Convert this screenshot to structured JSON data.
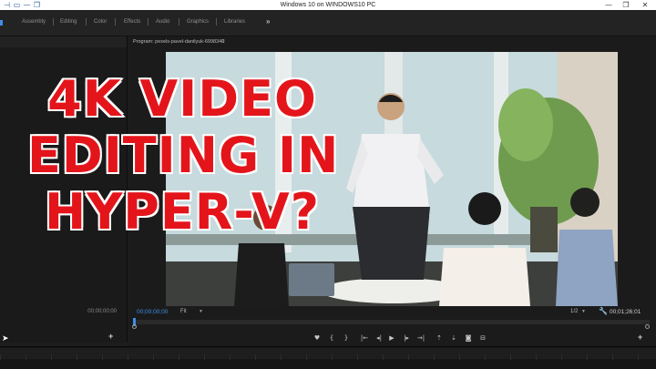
{
  "host": {
    "title": "Windows 10 on WINDOWS10 PC",
    "left_icons": [
      "pin-icon",
      "vm-icon",
      "minimize-icon",
      "restore-icon"
    ],
    "window_controls": [
      "minimize-icon",
      "restore-icon",
      "close-icon"
    ],
    "controls": {
      "minimize": "—",
      "restore": "❐",
      "close": "✕"
    }
  },
  "workspaces": {
    "tabs": [
      "Assembly",
      "Editing",
      "Color",
      "Effects",
      "Audio",
      "Graphics",
      "Libraries"
    ],
    "overflow": "»"
  },
  "program_monitor": {
    "tab_label": "Program: pexels-pavel-danilyuk-6998340",
    "tab_menu": "≡",
    "timecode_current": "00;00;00;00",
    "fit": "Fit",
    "resolution": "1/2",
    "timecode_duration": "00;01;26;01",
    "transport": [
      {
        "name": "add-marker-button",
        "glyph": "♥"
      },
      {
        "name": "mark-in-button",
        "glyph": "{"
      },
      {
        "name": "mark-out-button",
        "glyph": "}"
      },
      {
        "name": "go-to-in-button",
        "glyph": "|←"
      },
      {
        "name": "step-back-button",
        "glyph": "◂|"
      },
      {
        "name": "play-button",
        "glyph": "▶"
      },
      {
        "name": "step-forward-button",
        "glyph": "|▸"
      },
      {
        "name": "go-to-out-button",
        "glyph": "→|"
      },
      {
        "name": "lift-button",
        "glyph": "⇡"
      },
      {
        "name": "extract-button",
        "glyph": "⇣"
      },
      {
        "name": "export-frame-button",
        "glyph": "◙"
      },
      {
        "name": "comparison-view-button",
        "glyph": "⊟"
      }
    ],
    "add_button": "+"
  },
  "source_panel": {
    "timecode": "00;00;00;00",
    "add_button": "+"
  },
  "overlay": {
    "lines": [
      "4K VIDEO",
      "EDITING IN",
      "HYPER-V?"
    ],
    "color": "#e3151b",
    "stroke": "#ffffff"
  },
  "colors": {
    "accent_blue": "#3d8fe6",
    "panel_bg": "#1b1b1b"
  }
}
